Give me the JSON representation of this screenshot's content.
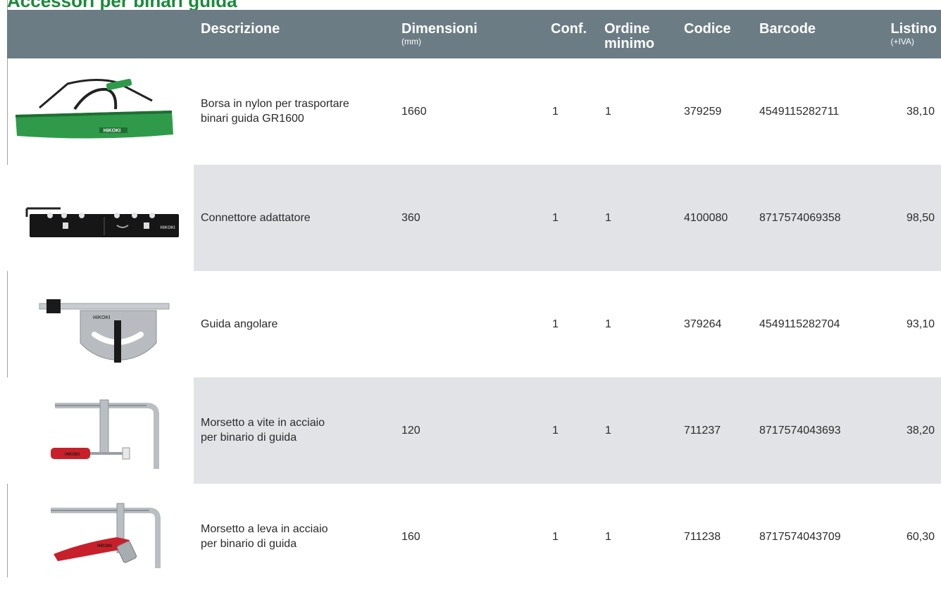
{
  "title": "Accessori per binari guida",
  "table": {
    "headers": {
      "descrizione": "Descrizione",
      "dimensioni": "Dimensioni",
      "dimensioni_unit": "(mm)",
      "conf": "Conf.",
      "ordine_line1": "Ordine",
      "ordine_line2": "minimo",
      "codice": "Codice",
      "barcode": "Barcode",
      "listino": "Listino",
      "listino_unit": "(+IVA)"
    },
    "rows": [
      {
        "desc_line1": "Borsa in nylon per trasportare",
        "desc_line2": "binari guida GR1600",
        "dimensioni": "1660",
        "conf": "1",
        "ordine": "1",
        "codice": "379259",
        "barcode": "4549115282711",
        "listino": "38,10",
        "image_icon": "carry-bag-icon"
      },
      {
        "desc_line1": "Connettore adattatore",
        "desc_line2": "",
        "dimensioni": "360",
        "conf": "1",
        "ordine": "1",
        "codice": "4100080",
        "barcode": "8717574069358",
        "listino": "98,50",
        "image_icon": "connector-bar-icon"
      },
      {
        "desc_line1": "Guida angolare",
        "desc_line2": "",
        "dimensioni": "",
        "conf": "1",
        "ordine": "1",
        "codice": "379264",
        "barcode": "4549115282704",
        "listino": "93,10",
        "image_icon": "angle-guide-icon"
      },
      {
        "desc_line1": "Morsetto a vite in acciaio",
        "desc_line2": "per binario di guida",
        "dimensioni": "120",
        "conf": "1",
        "ordine": "1",
        "codice": "711237",
        "barcode": "8717574043693",
        "listino": "38,20",
        "image_icon": "screw-clamp-icon"
      },
      {
        "desc_line1": "Morsetto a leva in acciaio",
        "desc_line2": "per binario di guida",
        "dimensioni": "160",
        "conf": "1",
        "ordine": "1",
        "codice": "711238",
        "barcode": "8717574043709",
        "listino": "60,30",
        "image_icon": "lever-clamp-icon"
      }
    ],
    "brand_mark": "HiKOKI"
  },
  "colors": {
    "header_bg": "#6b7c85",
    "alt_row_bg": "#e2e3e7",
    "title_green": "#1a8a3a",
    "bag_green": "#2f9b4a",
    "handle_red": "#c8202a"
  }
}
